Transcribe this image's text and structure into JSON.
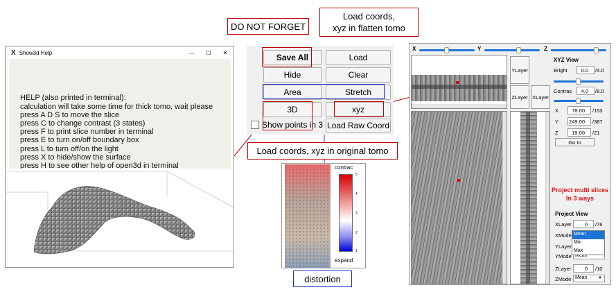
{
  "callouts": {
    "do_not_forget": "DO NOT FORGET",
    "load_coords_flatten": "Load coords,\nxyz in flatten tomo",
    "load_coords_original": "Load coords, xyz in original tomo",
    "distortion": "distortion",
    "project_multi": "Project multi slices\nIn 3 ways"
  },
  "help_window": {
    "title": "Show3d Help",
    "app_icon": "X",
    "controls": [
      "—",
      "☐",
      "✕"
    ],
    "text": "HELP (also printed in terminal):\ncalculation will take some time for thick tomo, wait please\npress A D S to move the slice\npress C to change contrast (3 states)\npress F to print slice number in terminal\npress E to turn on/off boundary box\npress L to turn off/on the light\npress X to hide/show the surface\npress H to see other help of open3d in terminal"
  },
  "panel": {
    "save_all": "Save All",
    "load": "Load",
    "hide": "Hide",
    "clear": "Clear",
    "area": "Area",
    "stretch": "Stretch",
    "btn_3d": "3D",
    "xyz": "xyz",
    "show_points": "Show points in 3",
    "load_raw": "Load Raw Coord"
  },
  "colorbar": {
    "label": "contrac",
    "expand": "expand",
    "ticks": [
      "5",
      "4",
      "3",
      "2",
      "1"
    ]
  },
  "viewer": {
    "slider_labels": [
      "X",
      "Y",
      "Z"
    ],
    "ylayer": "YLayer",
    "zlayer": "ZLayer",
    "xlayer": "XLayer",
    "xyz_view": "XYZ View",
    "bright_label": "Bright",
    "bright_value": "0.0",
    "bright_max": "/4.0",
    "contrast_label": "Contras",
    "contrast_value": "4.0",
    "contrast_max": "/8.0",
    "x_label": "X",
    "x_value": "78.00",
    "x_max": "/153",
    "y_label": "Y",
    "y_value": "249.00",
    "y_max": "/387",
    "z_label": "Z",
    "z_value": "19.00",
    "z_max": "/21",
    "goto": "Go to",
    "project_view": "Project View",
    "xlayer_label": "XLayer",
    "xlayer_value": "0",
    "xlayer_max": "/76",
    "xmode_label": "XMode",
    "ylayer_label": "YLayer",
    "ymode_label": "YMode",
    "ymode_value": "Mean",
    "zlayer_label": "ZLayer",
    "zlayer_value": "0",
    "zlayer_max": "/10",
    "zmode_label": "ZMode",
    "zmode_value": "Mean",
    "mode_options": [
      "Mean",
      "Min",
      "Max"
    ]
  },
  "colors": {
    "callout_border": "#c00000",
    "highlight_blue": "#1c2fc9",
    "accent": "#1e73d8",
    "project_text": "#e01010"
  }
}
